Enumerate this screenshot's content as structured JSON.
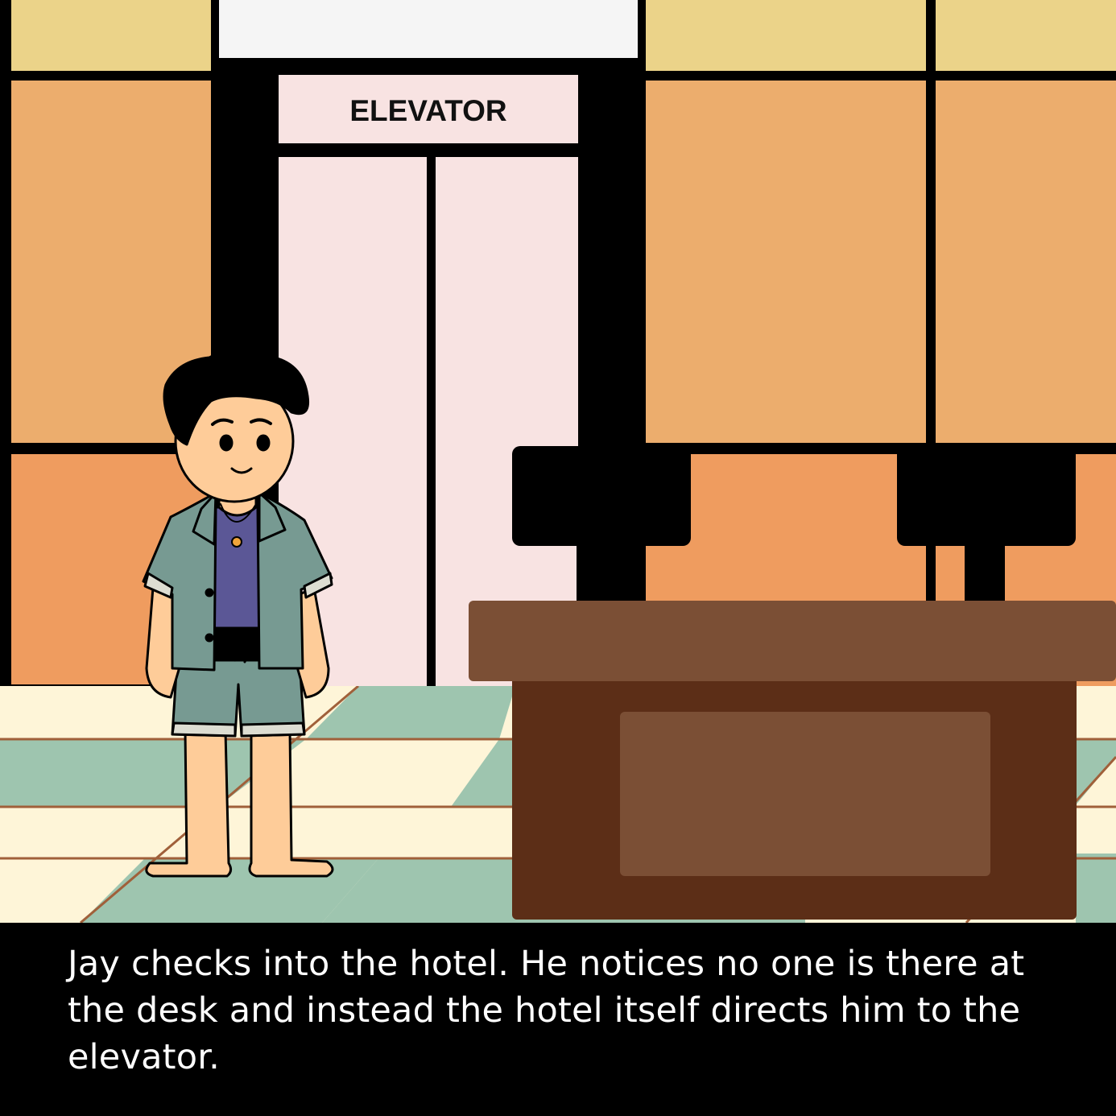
{
  "scene": {
    "sign_text": "ELEVATOR",
    "colors": {
      "wall_top": "#EBD389",
      "wall_mid": "#ECAD6D",
      "wall_low": "#EF9C5F",
      "elevator": "#F8E3E2",
      "floor_cream": "#FEF5D8",
      "floor_green": "#9EC5AF",
      "desk_top": "#7B4F35",
      "desk_body": "#5C2E17",
      "shirt": "#779A92",
      "tank": "#5B5796",
      "skin": "#FECC99",
      "hair": "#000000"
    }
  },
  "caption": "Jay checks into the hotel. He notices no one is there at the desk and instead the hotel itself directs him to the elevator."
}
